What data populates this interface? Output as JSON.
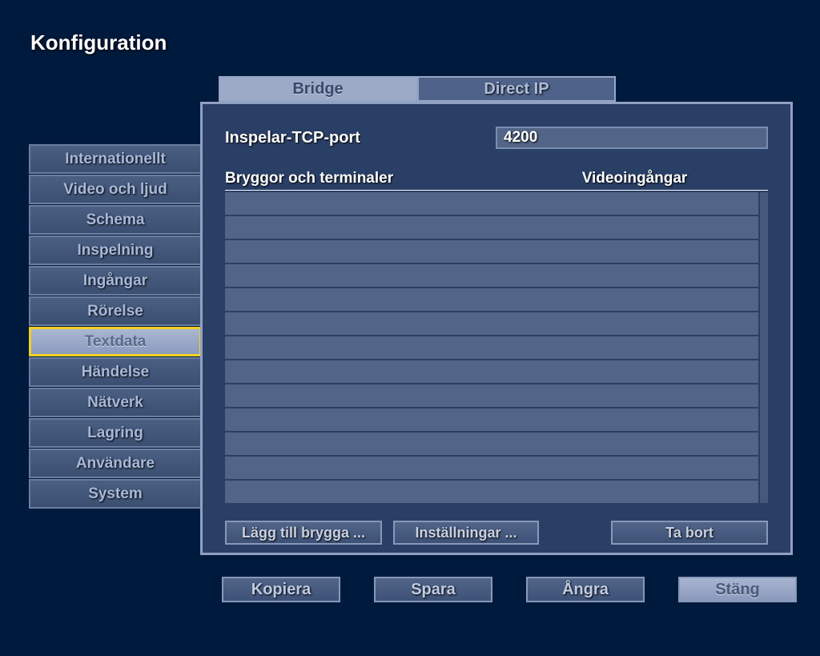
{
  "title": "Konfiguration",
  "sidebar": {
    "items": [
      {
        "label": "Internationellt",
        "selected": false
      },
      {
        "label": "Video och ljud",
        "selected": false
      },
      {
        "label": "Schema",
        "selected": false
      },
      {
        "label": "Inspelning",
        "selected": false
      },
      {
        "label": "Ingångar",
        "selected": false
      },
      {
        "label": "Rörelse",
        "selected": false
      },
      {
        "label": "Textdata",
        "selected": true
      },
      {
        "label": "Händelse",
        "selected": false
      },
      {
        "label": "Nätverk",
        "selected": false
      },
      {
        "label": "Lagring",
        "selected": false
      },
      {
        "label": "Användare",
        "selected": false
      },
      {
        "label": "System",
        "selected": false
      }
    ]
  },
  "tabs": [
    {
      "label": "Bridge",
      "active": true
    },
    {
      "label": "Direct IP",
      "active": false
    }
  ],
  "panel": {
    "tcp_port_label": "Inspelar-TCP-port",
    "tcp_port_value": "4200",
    "table_headers": {
      "col1": "Bryggor och terminaler",
      "col2": "Videoingångar"
    },
    "row_count": 13,
    "buttons": {
      "add": "Lägg till brygga ...",
      "settings": "Inställningar ...",
      "remove": "Ta bort"
    }
  },
  "footer_buttons": {
    "copy": "Kopiera",
    "save": "Spara",
    "undo": "Ångra",
    "close": "Stäng"
  }
}
